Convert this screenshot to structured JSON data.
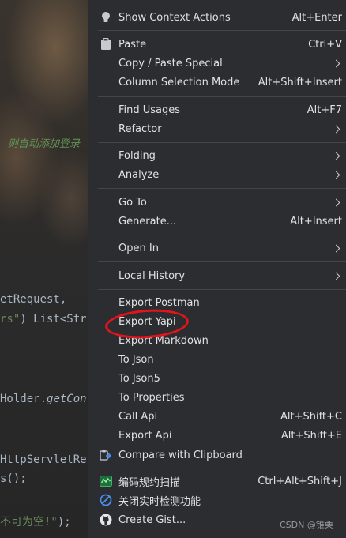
{
  "code": {
    "comment": "则自动添加登录",
    "line1": "etRequest,",
    "line2_str": "rs\"",
    "line2_rest": ") List<Str",
    "line3_plain": "Holder.",
    "line3_italic": "getCon",
    "line4": "HttpServletRe",
    "line5": "s();",
    "line6_str": "不可为空!\"",
    "line6_rest": ");"
  },
  "menu": {
    "items": [
      {
        "label": "Show Context Actions",
        "shortcut": "Alt+Enter",
        "icon": "lightbulb-icon"
      },
      {
        "label": "Paste",
        "shortcut": "Ctrl+V",
        "icon": "clipboard-icon"
      },
      {
        "label": "Copy / Paste Special",
        "submenu": true
      },
      {
        "label": "Column Selection Mode",
        "shortcut": "Alt+Shift+Insert"
      },
      {
        "label": "Find Usages",
        "shortcut": "Alt+F7"
      },
      {
        "label": "Refactor",
        "submenu": true
      },
      {
        "label": "Folding",
        "submenu": true
      },
      {
        "label": "Analyze",
        "submenu": true
      },
      {
        "label": "Go To",
        "submenu": true
      },
      {
        "label": "Generate...",
        "shortcut": "Alt+Insert"
      },
      {
        "label": "Open In",
        "submenu": true
      },
      {
        "label": "Local History",
        "submenu": true
      },
      {
        "label": "Export Postman"
      },
      {
        "label": "Export Yapi"
      },
      {
        "label": "Export Markdown"
      },
      {
        "label": "To Json"
      },
      {
        "label": "To Json5"
      },
      {
        "label": "To Properties"
      },
      {
        "label": "Call Api",
        "shortcut": "Alt+Shift+C"
      },
      {
        "label": "Export Api",
        "shortcut": "Alt+Shift+E"
      },
      {
        "label": "Compare with Clipboard",
        "icon": "compare-icon"
      },
      {
        "label": "编码规约扫描",
        "shortcut": "Ctrl+Alt+Shift+J",
        "icon": "scan-chart-icon"
      },
      {
        "label": "关闭实时检测功能",
        "icon": "no-entry-icon"
      },
      {
        "label": "Create Gist...",
        "icon": "github-icon"
      }
    ]
  },
  "watermark": "CSDN @锥栗",
  "colors": {
    "menu_bg": "#2b2d30",
    "annotation_circle": "#e3141b"
  }
}
